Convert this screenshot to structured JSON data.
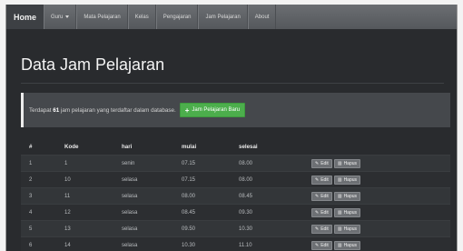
{
  "navbar": {
    "brand": "Home",
    "items": [
      {
        "label": "Guru",
        "dropdown": true
      },
      {
        "label": "Mata Pelajaran"
      },
      {
        "label": "Kelas"
      },
      {
        "label": "Pengajaran"
      },
      {
        "label": "Jam Pelajaran"
      },
      {
        "label": "About"
      }
    ]
  },
  "page": {
    "title": "Data Jam Pelajaran"
  },
  "alert": {
    "prefix": "Terdapat",
    "count": "61",
    "suffix": "jam pelajaran yang terdaftar dalam database.",
    "add_button": "Jam Pelajaran Baru"
  },
  "table": {
    "headers": [
      "#",
      "Kode",
      "hari",
      "mulai",
      "selesai"
    ],
    "edit_label": "Edit",
    "delete_label": "Hapus",
    "rows": [
      {
        "no": "1",
        "kode": "1",
        "hari": "senin",
        "mulai": "07.15",
        "selesai": "08.00"
      },
      {
        "no": "2",
        "kode": "10",
        "hari": "selasa",
        "mulai": "07.15",
        "selesai": "08.00"
      },
      {
        "no": "3",
        "kode": "11",
        "hari": "selasa",
        "mulai": "08.00",
        "selesai": "08.45"
      },
      {
        "no": "4",
        "kode": "12",
        "hari": "selasa",
        "mulai": "08.45",
        "selesai": "09.30"
      },
      {
        "no": "5",
        "kode": "13",
        "hari": "selasa",
        "mulai": "09.50",
        "selesai": "10.30"
      },
      {
        "no": "6",
        "kode": "14",
        "hari": "selasa",
        "mulai": "10.30",
        "selesai": "11.10"
      }
    ]
  },
  "icons": {
    "add": "plus-icon",
    "edit": "edit-icon",
    "delete": "trash-icon"
  },
  "colors": {
    "navbar": "#5f6266",
    "background": "#292b2e",
    "success": "#4cae4c"
  }
}
